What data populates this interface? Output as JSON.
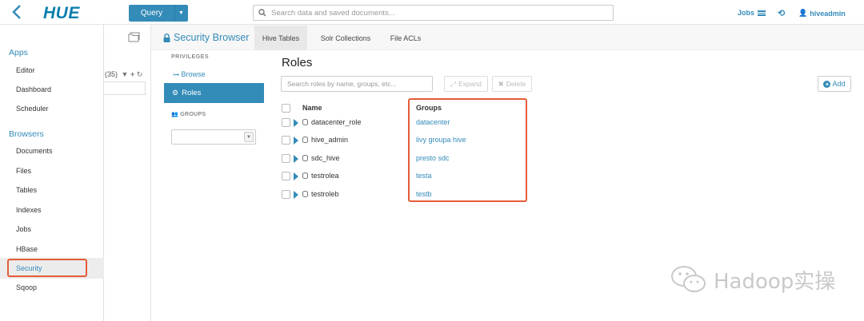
{
  "topbar": {
    "logo": "HUE",
    "query_label": "Query",
    "search_placeholder": "Search data and saved documents...",
    "jobs_label": "Jobs",
    "user_label": "hiveadmin"
  },
  "nav": {
    "apps_head": "Apps",
    "apps": [
      "Editor",
      "Dashboard",
      "Scheduler"
    ],
    "browsers_head": "Browsers",
    "browsers": [
      "Documents",
      "Files",
      "Tables",
      "Indexes",
      "Jobs",
      "HBase",
      "Security",
      "Sqoop"
    ],
    "active": "Security"
  },
  "assist": {
    "count": "(35)"
  },
  "app": {
    "title": "Security Browser",
    "tabs": [
      "Hive Tables",
      "Solr Collections",
      "File ACLs"
    ],
    "active_tab": "Hive Tables"
  },
  "privileges": {
    "head": "PRIVILEGES",
    "browse": "Browse",
    "roles": "Roles",
    "groups_head": "GROUPS"
  },
  "roles": {
    "title": "Roles",
    "search_placeholder": "Search roles by name, groups, etc...",
    "expand_label": "Expand",
    "delete_label": "Delete",
    "add_label": "Add",
    "col_name": "Name",
    "col_groups": "Groups",
    "rows": [
      {
        "name": "datacenter_role",
        "groups": "datacenter"
      },
      {
        "name": "hive_admin",
        "groups": "livy groupa hive"
      },
      {
        "name": "sdc_hive",
        "groups": "presto sdc"
      },
      {
        "name": "testrolea",
        "groups": "testa"
      },
      {
        "name": "testroleb",
        "groups": "testb"
      }
    ]
  },
  "watermark": "Hadoop实操",
  "colors": {
    "accent": "#338BB8",
    "highlight": "#E55B37"
  }
}
